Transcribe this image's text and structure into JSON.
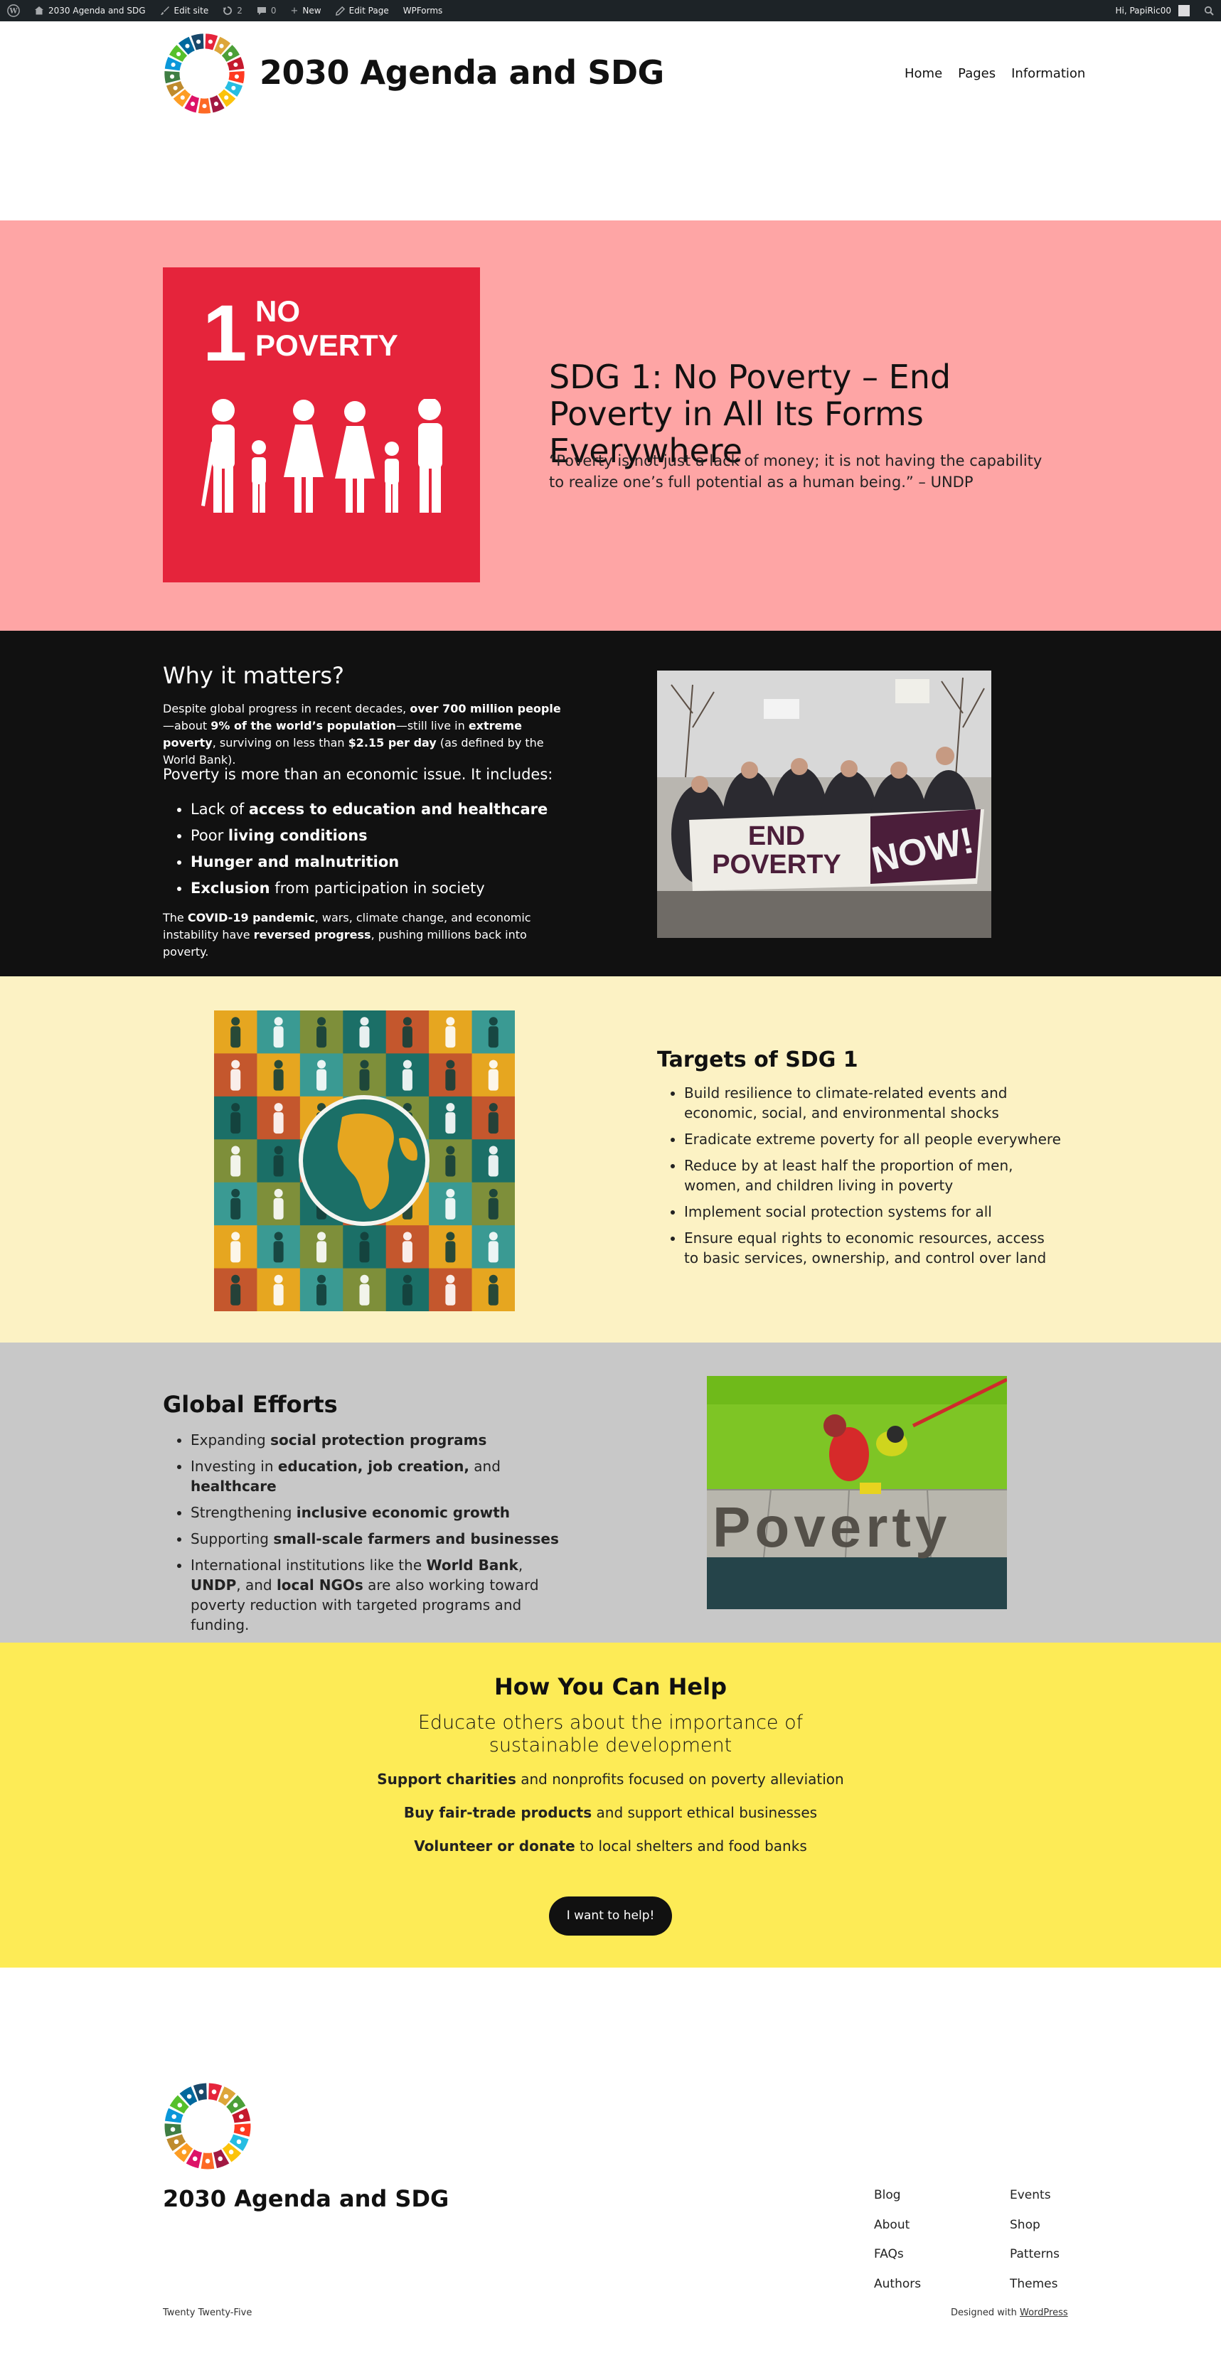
{
  "admin_bar": {
    "site_name": "2030 Agenda and SDG",
    "edit_site": "Edit site",
    "updates_count": "2",
    "comments_count": "0",
    "new": "New",
    "edit_page": "Edit Page",
    "wpforms": "WPForms",
    "greeting": "Hi, PapiRic00"
  },
  "header": {
    "site_title": "2030 Agenda and SDG",
    "nav": [
      "Home",
      "Pages",
      "Information"
    ]
  },
  "hero": {
    "tile_number": "1",
    "tile_label_line1": "NO",
    "tile_label_line2": "POVERTY",
    "title": "SDG 1: No Poverty – End Poverty in All Its Forms Everywhere",
    "quote": "“Poverty is not just a lack of money; it is not having the capability to realize one’s full potential as a human being.” – UNDP"
  },
  "why": {
    "heading": "Why it matters?",
    "p1_a": "Despite global progress in recent decades, ",
    "p1_b": "over 700 million people",
    "p1_c": "—about ",
    "p1_d": "9% of the world’s population",
    "p1_e": "—still live in ",
    "p1_f": "extreme poverty",
    "p1_g": ", surviving on less than ",
    "p1_h": "$2.15 per day",
    "p1_i": " (as defined by the World Bank).",
    "p2": "Poverty is more than an economic issue. It includes:",
    "items": [
      {
        "pre": "Lack of ",
        "bold": "access to education and healthcare",
        "post": ""
      },
      {
        "pre": "Poor ",
        "bold": "living conditions",
        "post": ""
      },
      {
        "pre": "",
        "bold": "Hunger and malnutrition",
        "post": ""
      },
      {
        "pre": "",
        "bold": "Exclusion",
        "post": " from participation in society"
      }
    ],
    "p3_a": "The ",
    "p3_b": "COVID-19 pandemic",
    "p3_c": ", wars, climate change, and economic instability have ",
    "p3_d": "reversed progress",
    "p3_e": ", pushing millions back into poverty.",
    "photo_banner_1": "END",
    "photo_banner_2": "POVERTY",
    "photo_banner_3": "NOW!"
  },
  "targets": {
    "heading": "Targets of SDG 1",
    "items": [
      "Build resilience to climate-related events and economic, social, and environmental shocks",
      "Eradicate extreme poverty for all people everywhere",
      "Reduce by at least half the proportion of men, women, and children living in poverty",
      "Implement social protection systems for all",
      "Ensure equal rights to economic resources, access to basic services, ownership, and control over land"
    ]
  },
  "global": {
    "heading": "Global Efforts",
    "items": [
      {
        "pre": "Expanding ",
        "bold": "social protection programs",
        "mid": "",
        "bold2": "",
        "post": ""
      },
      {
        "pre": "Investing in ",
        "bold": "education, job creation,",
        "mid": " and ",
        "bold2": "healthcare",
        "post": ""
      },
      {
        "pre": "Strengthening ",
        "bold": "inclusive economic growth",
        "mid": "",
        "bold2": "",
        "post": ""
      },
      {
        "pre": "Supporting ",
        "bold": "small-scale farmers and businesses",
        "mid": "",
        "bold2": "",
        "post": ""
      }
    ],
    "last_a": "International institutions like the ",
    "last_b": "World Bank",
    "last_c": ", ",
    "last_d": "UNDP",
    "last_e": ", and ",
    "last_f": "local NGOs",
    "last_g": " are also working toward poverty reduction with targeted programs and funding.",
    "image_text": "Poverty"
  },
  "help": {
    "heading": "How You Can Help",
    "sub": "Educate others about the importance of sustainable development",
    "l1_bold": "Support charities",
    "l1_rest": " and nonprofits focused on poverty alleviation",
    "l2_bold": "Buy fair-trade products",
    "l2_rest": " and support ethical businesses",
    "l3_bold": "Volunteer or donate",
    "l3_rest": " to local shelters and food banks",
    "button": "I want to help!"
  },
  "footer": {
    "title": "2030 Agenda and SDG",
    "col1": [
      "Blog",
      "About",
      "FAQs",
      "Authors"
    ],
    "col2": [
      "Events",
      "Shop",
      "Patterns",
      "Themes"
    ],
    "theme": "Twenty Twenty-Five",
    "credit_prefix": "Designed with ",
    "credit_link": "WordPress"
  },
  "colors": {
    "hero_bg": "#fea5a5",
    "why_bg": "#111111",
    "targets_bg": "#fcf2c4",
    "global_bg": "#c8c8c8",
    "help_bg": "#fdeb56",
    "sdg1_red": "#e5243b"
  }
}
